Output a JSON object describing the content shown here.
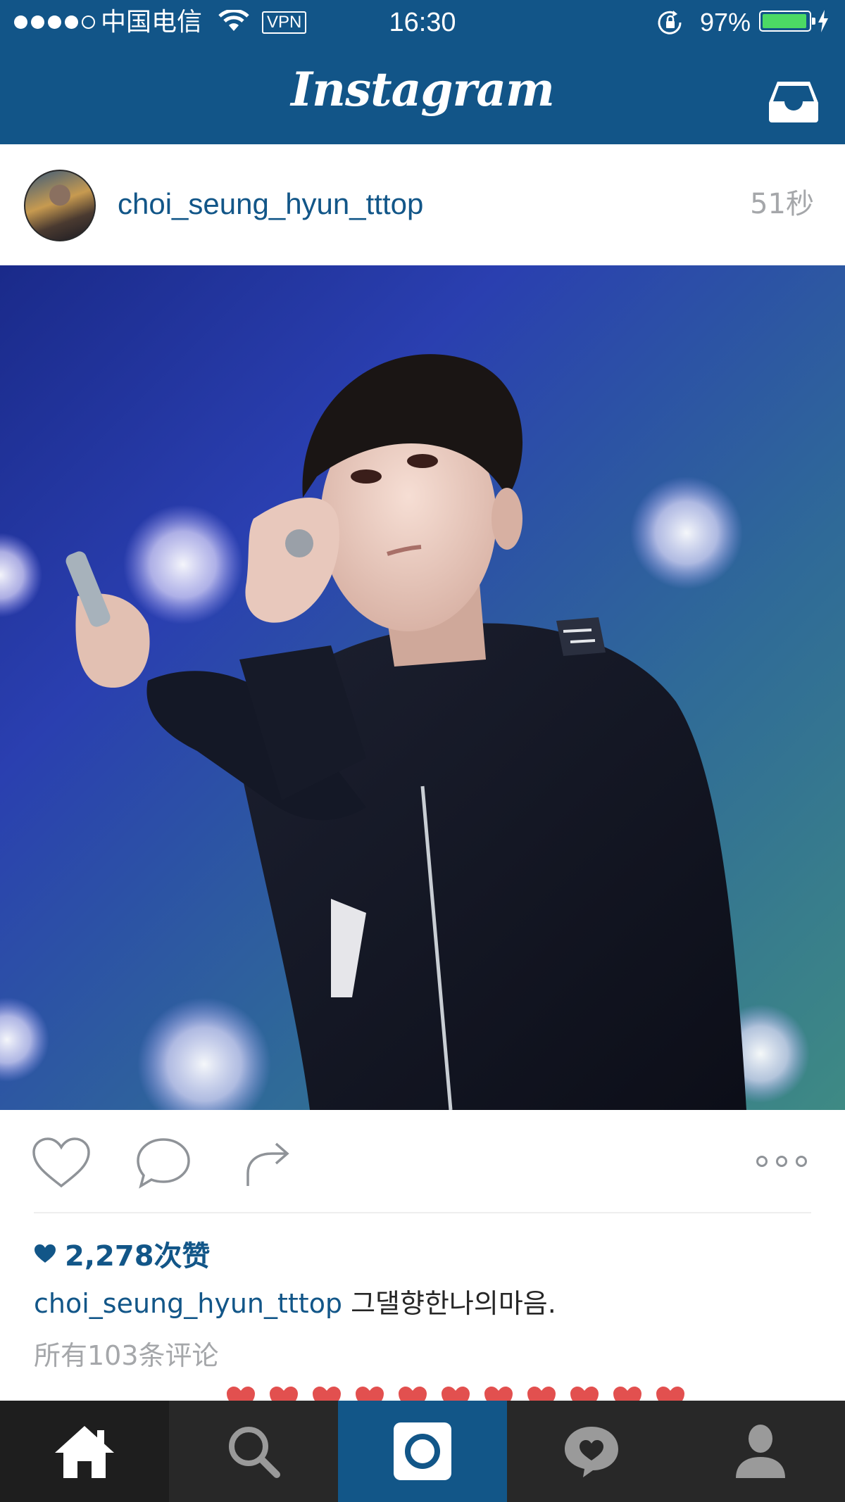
{
  "status_bar": {
    "carrier": "中国电信",
    "vpn": "VPN",
    "time": "16:30",
    "battery_percent": "97%",
    "battery_level": 0.97,
    "signal_bars_filled": 4,
    "signal_bars_total": 5
  },
  "nav": {
    "logo": "Instagram",
    "inbox_icon": "inbox-tray-icon"
  },
  "post": {
    "username": "choi_seung_hyun_tttop",
    "time_ago": "51秒",
    "photo_alt": "concert photo",
    "likes": "2,278次赞",
    "caption_user": "choi_seung_hyun_tttop",
    "caption_text": "그댈향한나의마음.",
    "view_comments": "所有103条评论"
  },
  "actions": {
    "like_icon": "heart-outline-icon",
    "comment_icon": "speech-bubble-icon",
    "share_icon": "share-arrow-icon",
    "more_icon": "more-dots-icon"
  },
  "tabbar": {
    "items": [
      {
        "name": "home",
        "icon": "home-icon",
        "active": true
      },
      {
        "name": "search",
        "icon": "search-icon",
        "active": false
      },
      {
        "name": "camera",
        "icon": "camera-icon",
        "active": false
      },
      {
        "name": "activity",
        "icon": "activity-heart-icon",
        "active": false
      },
      {
        "name": "profile",
        "icon": "profile-icon",
        "active": false
      }
    ]
  },
  "colors": {
    "brand_blue": "#125688",
    "secondary_text": "#a5a7aa",
    "tabbar_bg": "#282828",
    "battery_green": "#4cd964"
  }
}
